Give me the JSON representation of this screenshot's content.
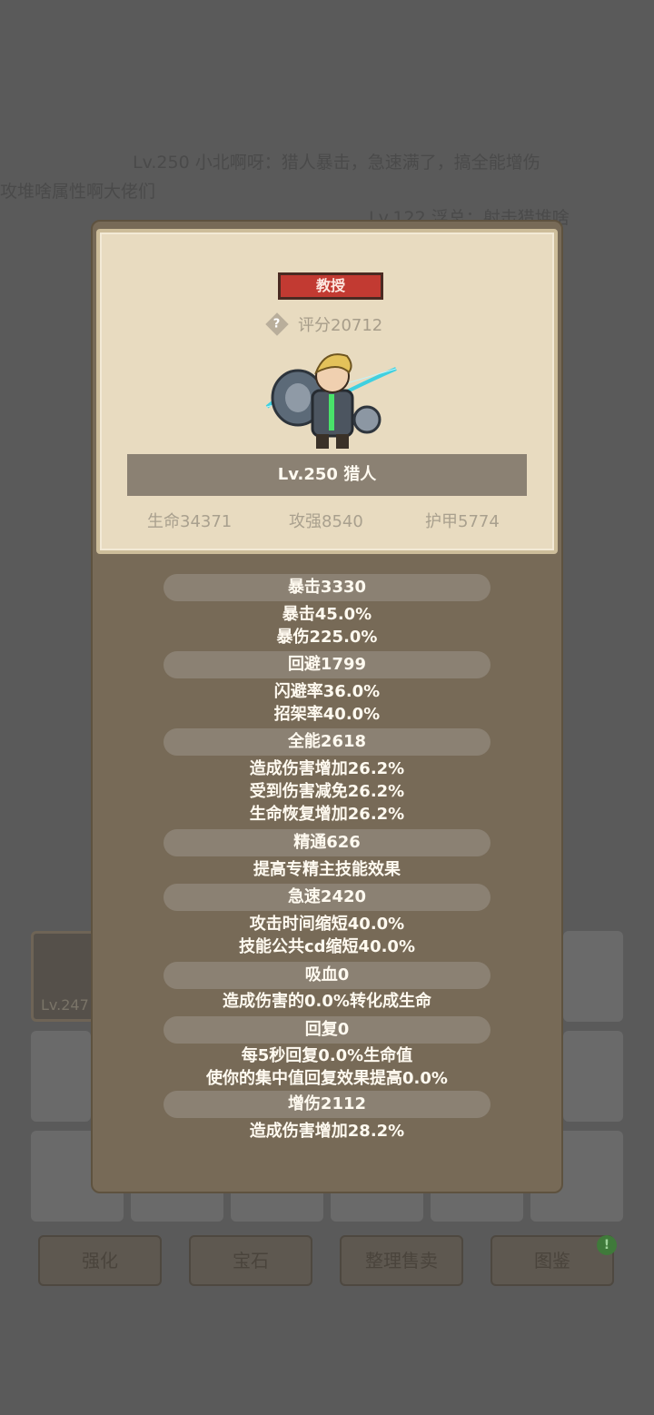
{
  "background": {
    "chat": [
      "Lv.250 小北啊呀：猎人暴击，急速满了，搞全能增伤",
      "攻堆啥属性啊大佬们",
      "Lv.122 浮总：射击猎堆啥"
    ],
    "inventory_item_level": "Lv.247",
    "buttons": [
      "强化",
      "宝石",
      "整理售卖",
      "图鉴"
    ],
    "badge": "!"
  },
  "modal": {
    "rank": "教授",
    "score_icon": "?",
    "score": "评分20712",
    "hero_name": "Lv.250 猎人",
    "stats": [
      "生命34371",
      "攻强8540",
      "护甲5774"
    ],
    "sections": [
      {
        "title": "暴击3330",
        "lines": [
          "暴击45.0%",
          "暴伤225.0%"
        ]
      },
      {
        "title": "回避1799",
        "lines": [
          "闪避率36.0%",
          "招架率40.0%"
        ]
      },
      {
        "title": "全能2618",
        "lines": [
          "造成伤害增加26.2%",
          "受到伤害减免26.2%",
          "生命恢复增加26.2%"
        ]
      },
      {
        "title": "精通626",
        "lines": [
          "提高专精主技能效果"
        ]
      },
      {
        "title": "急速2420",
        "lines": [
          "攻击时间缩短40.0%",
          "技能公共cd缩短40.0%"
        ]
      },
      {
        "title": "吸血0",
        "lines": [
          "造成伤害的0.0%转化成生命"
        ]
      },
      {
        "title": "回复0",
        "lines": [
          "每5秒回复0.0%生命值",
          "使你的集中值回复效果提高0.0%"
        ]
      },
      {
        "title": "增伤2112",
        "lines": [
          "造成伤害增加28.2%"
        ]
      }
    ]
  }
}
